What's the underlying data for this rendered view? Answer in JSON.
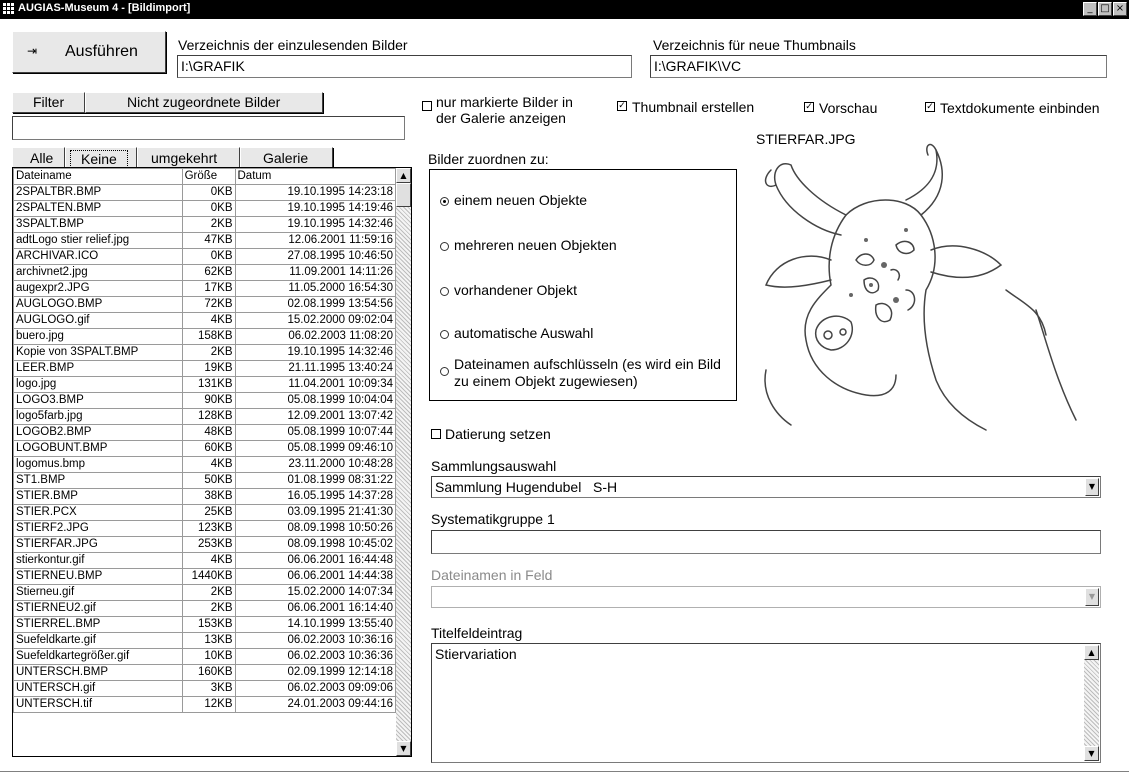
{
  "window": {
    "title": "AUGIAS-Museum 4 - [Bildimport]"
  },
  "toolbar": {
    "execute_label": "Ausführen"
  },
  "source_dir": {
    "label": "Verzeichnis der einzulesenden Bilder",
    "value": "I:\\GRAFIK"
  },
  "thumb_dir": {
    "label": "Verzeichnis für neue Thumbnails",
    "value": "I:\\GRAFIK\\VC"
  },
  "filter": {
    "filter_label": "Filter",
    "unassigned_label": "Nicht zugeordnete Bilder",
    "value": ""
  },
  "selection_buttons": {
    "all": "Alle",
    "none": "Keine",
    "invert": "umgekehrt",
    "gallery": "Galerie"
  },
  "options": {
    "only_marked": "nur markierte Bilder in der Galerie anzeigen",
    "create_thumbnail": "Thumbnail erstellen",
    "preview": "Vorschau",
    "include_text": "Textdokumente einbinden",
    "only_marked_line1": "nur markierte Bilder in",
    "only_marked_line2": "der Galerie anzeigen"
  },
  "preview": {
    "filename": "STIERFAR.JPG"
  },
  "assign": {
    "label": "Bilder zuordnen zu:",
    "options": [
      "einem neuen Objekte",
      "mehreren neuen Objekten",
      "vorhandener Objekt",
      "automatische Auswahl",
      "Dateinamen aufschlüsseln (es wird ein Bild zu einem Objekt zugewiesen)"
    ],
    "opt5_line1": "Dateinamen aufschlüsseln (es wird ein Bild",
    "opt5_line2": "zu einem Objekt zugewiesen)",
    "selected_index": 0
  },
  "dating": {
    "label": "Datierung setzen"
  },
  "collection": {
    "label": "Sammlungsauswahl",
    "value": "Sammlung Hugendubel   S-H"
  },
  "systematics": {
    "label": "Systematikgruppe 1",
    "value": ""
  },
  "filename_field": {
    "label": "Dateinamen in Feld",
    "value": ""
  },
  "title_field": {
    "label": "Titelfeldeintrag",
    "value": "Stiervariation"
  },
  "files": {
    "headers": [
      "Dateiname",
      "Größe",
      "Datum"
    ],
    "rows": [
      [
        "2SPALTBR.BMP",
        "0KB",
        "19.10.1995 14:23:18"
      ],
      [
        "2SPALTEN.BMP",
        "0KB",
        "19.10.1995 14:19:46"
      ],
      [
        "3SPALT.BMP",
        "2KB",
        "19.10.1995 14:32:46"
      ],
      [
        "adtLogo stier relief.jpg",
        "47KB",
        "12.06.2001 11:59:16"
      ],
      [
        "ARCHIVAR.ICO",
        "0KB",
        "27.08.1995 10:46:50"
      ],
      [
        "archivnet2.jpg",
        "62KB",
        "11.09.2001 14:11:26"
      ],
      [
        "augexpr2.JPG",
        "17KB",
        "11.05.2000 16:54:30"
      ],
      [
        "AUGLOGO.BMP",
        "72KB",
        "02.08.1999 13:54:56"
      ],
      [
        "AUGLOGO.gif",
        "4KB",
        "15.02.2000 09:02:04"
      ],
      [
        "buero.jpg",
        "158KB",
        "06.02.2003 11:08:20"
      ],
      [
        "Kopie von 3SPALT.BMP",
        "2KB",
        "19.10.1995 14:32:46"
      ],
      [
        "LEER.BMP",
        "19KB",
        "21.11.1995 13:40:24"
      ],
      [
        "logo.jpg",
        "131KB",
        "11.04.2001 10:09:34"
      ],
      [
        "LOGO3.BMP",
        "90KB",
        "05.08.1999 10:04:04"
      ],
      [
        "logo5farb.jpg",
        "128KB",
        "12.09.2001 13:07:42"
      ],
      [
        "LOGOB2.BMP",
        "48KB",
        "05.08.1999 10:07:44"
      ],
      [
        "LOGOBUNT.BMP",
        "60KB",
        "05.08.1999 09:46:10"
      ],
      [
        "logomus.bmp",
        "4KB",
        "23.11.2000 10:48:28"
      ],
      [
        "ST1.BMP",
        "50KB",
        "01.08.1999 08:31:22"
      ],
      [
        "STIER.BMP",
        "38KB",
        "16.05.1995 14:37:28"
      ],
      [
        "STIER.PCX",
        "25KB",
        "03.09.1995 21:41:30"
      ],
      [
        "STIERF2.JPG",
        "123KB",
        "08.09.1998 10:50:26"
      ],
      [
        "STIERFAR.JPG",
        "253KB",
        "08.09.1998 10:45:02"
      ],
      [
        "stierkontur.gif",
        "4KB",
        "06.06.2001 16:44:48"
      ],
      [
        "STIERNEU.BMP",
        "1440KB",
        "06.06.2001 14:44:38"
      ],
      [
        "Stierneu.gif",
        "2KB",
        "15.02.2000 14:07:34"
      ],
      [
        "STIERNEU2.gif",
        "2KB",
        "06.06.2001 16:14:40"
      ],
      [
        "STIERREL.BMP",
        "153KB",
        "14.10.1999 13:55:40"
      ],
      [
        "Suefeldkarte.gif",
        "13KB",
        "06.02.2003 10:36:16"
      ],
      [
        "Suefeldkartegrößer.gif",
        "10KB",
        "06.02.2003 10:36:36"
      ],
      [
        "UNTERSCH.BMP",
        "160KB",
        "02.09.1999 12:14:18"
      ],
      [
        "UNTERSCH.gif",
        "3KB",
        "06.02.2003 09:09:06"
      ],
      [
        "UNTERSCH.tif",
        "12KB",
        "24.01.2003 09:44:16"
      ]
    ]
  }
}
